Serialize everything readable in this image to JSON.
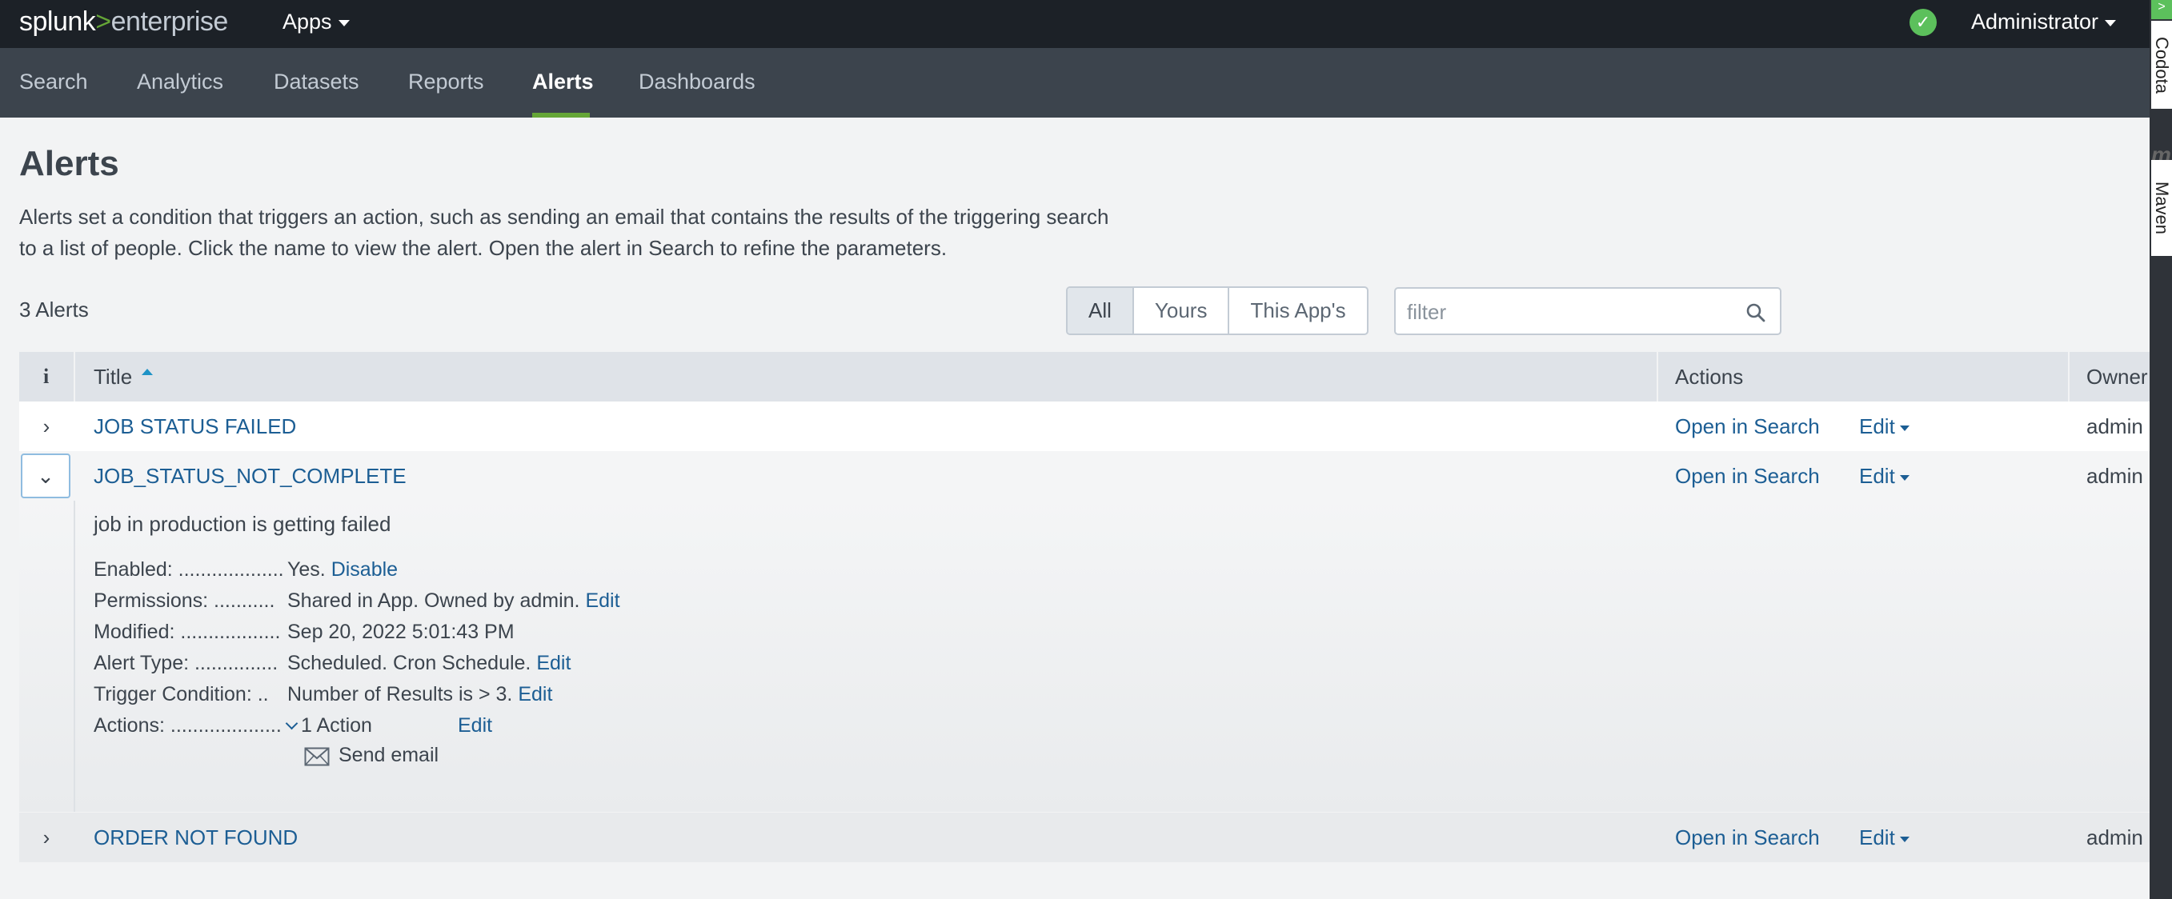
{
  "topbar": {
    "logo_splunk": "splunk",
    "logo_gt": ">",
    "logo_enterprise": "enterprise",
    "apps_label": "Apps",
    "user_label": "Administrator",
    "status_check": "✓"
  },
  "nav": {
    "items": [
      "Search",
      "Analytics",
      "Datasets",
      "Reports",
      "Alerts",
      "Dashboards"
    ],
    "active": "Alerts"
  },
  "sidebar": {
    "codota": "Codota",
    "maven": "Maven",
    "m": "m",
    "arrow": ">"
  },
  "page": {
    "title": "Alerts",
    "description": "Alerts set a condition that triggers an action, such as sending an email that contains the results of the triggering search to a list of people. Click the name to view the alert. Open the alert in Search to refine the parameters.",
    "count": "3 Alerts"
  },
  "filter_tabs": [
    "All",
    "Yours",
    "This App's"
  ],
  "filter": {
    "placeholder": "filter",
    "value": ""
  },
  "table": {
    "headers": {
      "info": "i",
      "title": "Title",
      "actions": "Actions",
      "owner": "Owner"
    },
    "rows": [
      {
        "title": "JOB STATUS FAILED",
        "open": "Open in Search",
        "edit": "Edit",
        "owner": "admin",
        "expand": "›"
      },
      {
        "title": "JOB_STATUS_NOT_COMPLETE",
        "open": "Open in Search",
        "edit": "Edit",
        "owner": "admin",
        "expand": "⌄"
      },
      {
        "title": "ORDER NOT FOUND",
        "open": "Open in Search",
        "edit": "Edit",
        "owner": "admin",
        "expand": "›"
      }
    ]
  },
  "details": {
    "description": "job in production is getting failed",
    "enabled_label": "Enabled: ...................",
    "enabled_value": "Yes.",
    "enabled_link": "Disable",
    "permissions_label": "Permissions: ...........",
    "permissions_value": "Shared in App. Owned by admin.",
    "permissions_link": "Edit",
    "modified_label": "Modified: ..................",
    "modified_value": "Sep 20, 2022 5:01:43 PM",
    "alert_type_label": "Alert Type: ...............",
    "alert_type_value": "Scheduled. Cron Schedule.",
    "alert_type_link": "Edit",
    "trigger_label": "Trigger Condition: ..",
    "trigger_value": "Number of Results is > 3.",
    "trigger_link": "Edit",
    "actions_label": "Actions: ....................",
    "actions_value": "1 Action",
    "actions_link": "Edit",
    "send_email": "Send email"
  },
  "colors": {
    "topbar": "#1c2127",
    "navbar": "#3c444d",
    "accent_green": "#65a637",
    "link_blue": "#1c5e94"
  }
}
